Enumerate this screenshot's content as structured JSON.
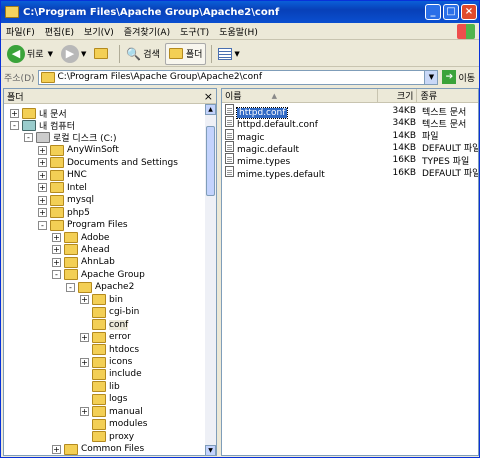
{
  "window": {
    "title": "C:\\Program Files\\Apache Group\\Apache2\\conf"
  },
  "menu": [
    "파일(F)",
    "편집(E)",
    "보기(V)",
    "즐겨찾기(A)",
    "도구(T)",
    "도움말(H)"
  ],
  "toolbar": {
    "back": "뒤로",
    "search": "검색",
    "folders": "폴더"
  },
  "address": {
    "label": "주소(D)",
    "value": "C:\\Program Files\\Apache Group\\Apache2\\conf",
    "go": "이동"
  },
  "tree": {
    "header": "폴더",
    "close": "×",
    "nodes": [
      {
        "label": "내 문서",
        "exp": "+"
      },
      {
        "label": "내 컴퓨터",
        "exp": "-"
      },
      {
        "label": "로컬 디스크 (C:)",
        "exp": "-"
      },
      {
        "label": "AnyWinSoft",
        "exp": "+"
      },
      {
        "label": "Documents and Settings",
        "exp": "+"
      },
      {
        "label": "HNC",
        "exp": "+"
      },
      {
        "label": "Intel",
        "exp": "+"
      },
      {
        "label": "mysql",
        "exp": "+"
      },
      {
        "label": "php5",
        "exp": "+"
      },
      {
        "label": "Program Files",
        "exp": "-"
      },
      {
        "label": "Adobe",
        "exp": "+"
      },
      {
        "label": "Ahead",
        "exp": "+"
      },
      {
        "label": "AhnLab",
        "exp": "+"
      },
      {
        "label": "Apache Group",
        "exp": "-"
      },
      {
        "label": "Apache2",
        "exp": "-"
      },
      {
        "label": "bin",
        "exp": "+"
      },
      {
        "label": "cgi-bin",
        "exp": ""
      },
      {
        "label": "conf",
        "exp": ""
      },
      {
        "label": "error",
        "exp": "+"
      },
      {
        "label": "htdocs",
        "exp": ""
      },
      {
        "label": "icons",
        "exp": "+"
      },
      {
        "label": "include",
        "exp": ""
      },
      {
        "label": "lib",
        "exp": ""
      },
      {
        "label": "logs",
        "exp": ""
      },
      {
        "label": "manual",
        "exp": "+"
      },
      {
        "label": "modules",
        "exp": ""
      },
      {
        "label": "proxy",
        "exp": ""
      },
      {
        "label": "Common Files",
        "exp": "+"
      }
    ]
  },
  "list": {
    "columns": {
      "name": "이름",
      "size": "크기",
      "type": "종류"
    },
    "files": [
      {
        "name": "httpd.conf",
        "size": "34KB",
        "type": "텍스트 문서"
      },
      {
        "name": "httpd.default.conf",
        "size": "34KB",
        "type": "텍스트 문서"
      },
      {
        "name": "magic",
        "size": "14KB",
        "type": "파일"
      },
      {
        "name": "magic.default",
        "size": "14KB",
        "type": "DEFAULT 파일"
      },
      {
        "name": "mime.types",
        "size": "16KB",
        "type": "TYPES 파일"
      },
      {
        "name": "mime.types.default",
        "size": "16KB",
        "type": "DEFAULT 파일"
      }
    ]
  }
}
